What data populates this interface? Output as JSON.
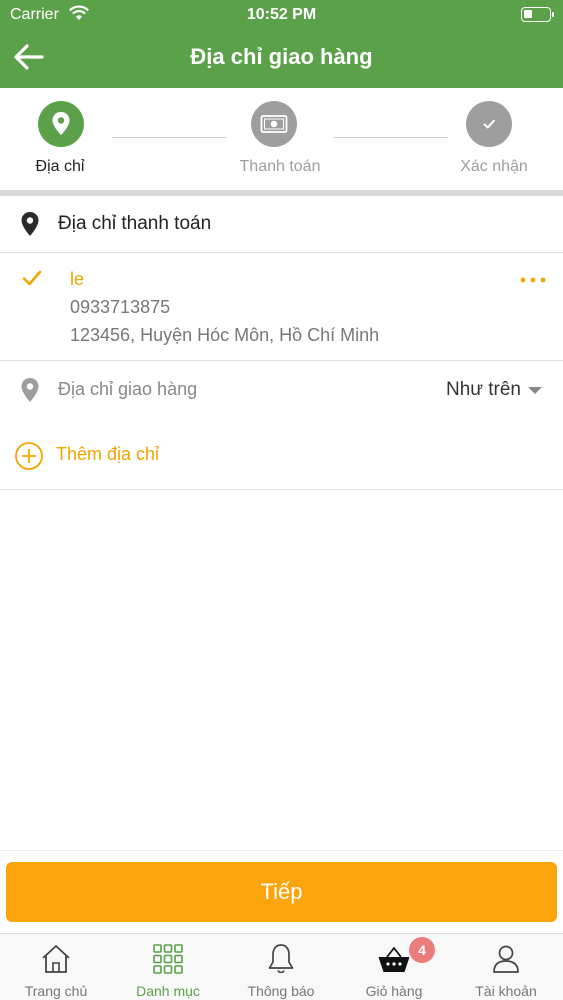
{
  "status_bar": {
    "carrier": "Carrier",
    "time": "10:52 PM"
  },
  "header": {
    "title": "Địa chỉ giao hàng"
  },
  "steps": [
    {
      "label": "Địa chỉ",
      "state": "active"
    },
    {
      "label": "Thanh toán",
      "state": "inactive"
    },
    {
      "label": "Xác nhận",
      "state": "inactive"
    }
  ],
  "billing": {
    "title": "Địa chỉ thanh toán",
    "name": "le",
    "phone": "0933713875",
    "address": "123456, Huyện Hóc Môn, Hồ Chí Minh"
  },
  "shipping": {
    "label": "Địa chỉ giao hàng",
    "value": "Như trên"
  },
  "add_address": {
    "label": "Thêm địa chỉ"
  },
  "next_button": {
    "label": "Tiếp"
  },
  "tabbar": {
    "items": [
      {
        "label": "Trang chủ",
        "icon": "home-icon"
      },
      {
        "label": "Danh mục",
        "icon": "grid-icon",
        "active": true
      },
      {
        "label": "Thông báo",
        "icon": "bell-icon"
      },
      {
        "label": "Giỏ hàng",
        "icon": "basket-icon"
      },
      {
        "label": "Tài khoản",
        "icon": "user-icon"
      }
    ],
    "cart_badge": "4"
  },
  "colors": {
    "brand_green": "#5aa14a",
    "accent_orange": "#fca40c",
    "accent_text_orange": "#f0a500",
    "inactive_gray": "#9e9e9e",
    "badge_red": "#ec7b7b"
  }
}
